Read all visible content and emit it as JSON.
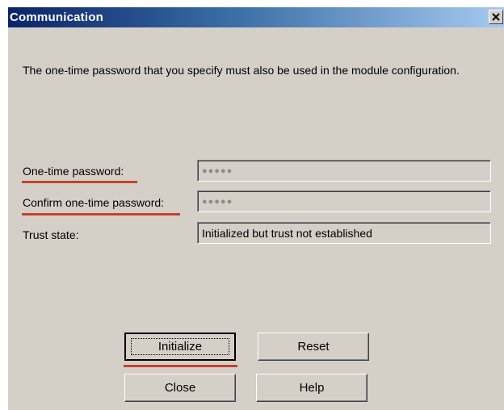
{
  "window": {
    "title": "Communication",
    "close_glyph": "✕"
  },
  "message": "The one-time password that you specify must also be used in the module configuration.",
  "fields": {
    "one_time_password": {
      "label": "One-time password:",
      "value": "●●●●●"
    },
    "confirm_password": {
      "label": "Confirm one-time password:",
      "value": "●●●●●"
    },
    "trust_state": {
      "label": "Trust state:",
      "value": "Initialized but trust not established"
    }
  },
  "buttons": {
    "initialize": "Initialize",
    "reset": "Reset",
    "close": "Close",
    "help": "Help"
  },
  "colors": {
    "highlight_underline": "#c8412b",
    "titlebar_start": "#0a246a",
    "titlebar_end": "#a6caf0",
    "dialog_bg": "#d4d0c8"
  }
}
